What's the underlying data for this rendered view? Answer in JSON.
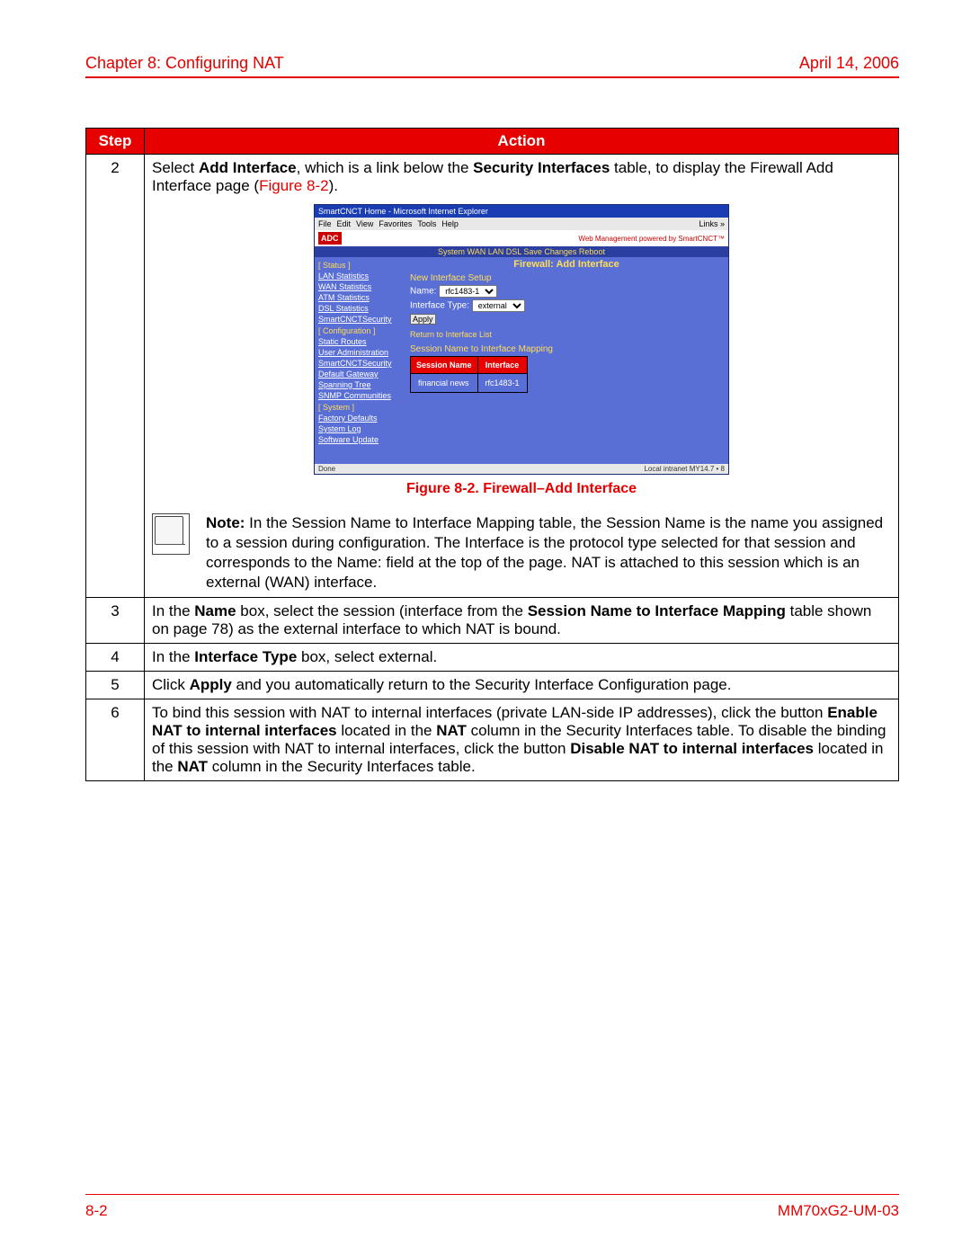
{
  "header": {
    "chapter": "Chapter 8: Configuring NAT",
    "date": "April 14, 2006"
  },
  "table": {
    "headers": {
      "step": "Step",
      "action": "Action"
    },
    "rows": [
      {
        "num": "2",
        "intro_pre": "Select ",
        "intro_b1": "Add Interface",
        "intro_mid": ", which is a link below the ",
        "intro_b2": "Security Interfaces",
        "intro_post": " table, to display the Firewall Add Interface page (",
        "intro_figref": "Figure 8-2",
        "intro_end": ").",
        "caption": "Figure 8-2. Firewall–Add Interface",
        "note_label": "Note:",
        "note_text": " In the Session Name to Interface Mapping table, the Session Name is the name you assigned to a session during configuration. The Interface is the protocol type selected for that session and corresponds to the Name: field at the top of the page. NAT is attached to this session which is an external (WAN) interface."
      },
      {
        "num": "3",
        "pre": "In the ",
        "b1": "Name",
        "mid": " box, select the session (interface from the ",
        "b2": "Session Name to Interface Mapping",
        "post": " table shown on page 78) as the external interface to which NAT is bound."
      },
      {
        "num": "4",
        "pre": "In the ",
        "b1": "Interface Type",
        "post": " box, select external."
      },
      {
        "num": "5",
        "pre": "Click ",
        "b1": "Apply",
        "post": " and you automatically return to the Security Interface Configuration page."
      },
      {
        "num": "6",
        "p1": "To bind this session with NAT to internal interfaces (private LAN-side IP addresses), click the button ",
        "b1": "Enable NAT to internal interfaces",
        "p2": " located in the ",
        "b2": "NAT",
        "p3": " column in the Security Interfaces table. To disable the binding of this session with NAT to internal interfaces, click the button ",
        "b3": "Disable NAT to internal interfaces",
        "p4": " located in the ",
        "b4": "NAT",
        "p5": " column in the Security Interfaces table."
      }
    ]
  },
  "screenshot": {
    "title": "SmartCNCT Home - Microsoft Internet Explorer",
    "menu": [
      "File",
      "Edit",
      "View",
      "Favorites",
      "Tools",
      "Help"
    ],
    "links_label": "Links »",
    "logo": "ADC",
    "tagline": "Web Management powered by SmartCNCT™",
    "topnav": "System   WAN   LAN   DSL   Save Changes   Reboot",
    "page_title": "Firewall: Add Interface",
    "section1": "New Interface Setup",
    "name_label": "Name:",
    "name_value": "rfc1483-1",
    "type_label": "Interface Type:",
    "type_value": "external",
    "apply": "Apply",
    "return": "Return to Interface List",
    "section2": "Session Name to Interface Mapping",
    "col1": "Session Name",
    "col2": "Interface",
    "cell1": "financial news",
    "cell2": "rfc1483-1",
    "side_sections": {
      "status": "[ Status ]",
      "config": "[ Configuration ]",
      "system": "[ System ]"
    },
    "side_links_status": [
      "LAN Statistics",
      "WAN Statistics",
      "ATM Statistics",
      "DSL Statistics",
      "SmartCNCTSecurity"
    ],
    "side_links_config": [
      "Static Routes",
      "User Administration",
      "SmartCNCTSecurity",
      "Default Gateway",
      "Spanning Tree",
      "SNMP Communities"
    ],
    "side_links_system": [
      "Factory Defaults",
      "System Log",
      "Software Update"
    ],
    "status_left": "Done",
    "status_right": "Local intranet  MY14.7 • 8"
  },
  "footer": {
    "page": "8-2",
    "doc": "MM70xG2-UM-03"
  }
}
